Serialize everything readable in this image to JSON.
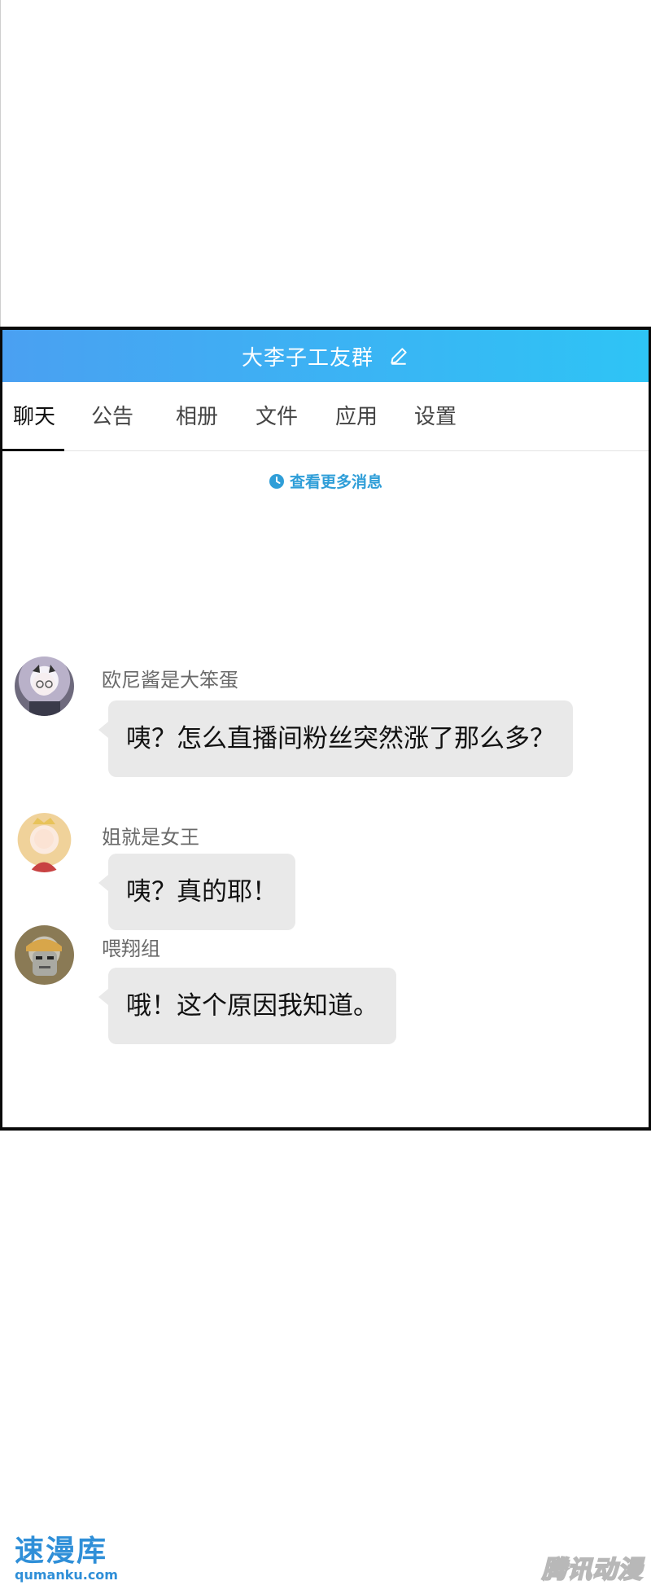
{
  "header": {
    "title": "大李子工友群",
    "edit_icon": "edit-pencil-icon"
  },
  "tabs": [
    "聊天",
    "公告",
    "相册",
    "文件",
    "应用",
    "设置"
  ],
  "active_tab": "聊天",
  "more_messages": {
    "label": "查看更多消息",
    "icon": "clock-icon"
  },
  "messages": [
    {
      "sender": "欧尼酱是大笨蛋",
      "text": "咦？怎么直播间粉丝突然涨了那么多？"
    },
    {
      "sender": "姐就是女王",
      "text": "咦？真的耶！"
    },
    {
      "sender": "喂翔组",
      "text": "哦！这个原因我知道。"
    }
  ],
  "colors": {
    "header_gradient_start": "#4aa0f2",
    "header_gradient_end": "#2ec4f5",
    "link_blue": "#2f9ed8",
    "bubble_bg": "#e9e9e9"
  },
  "watermarks": {
    "left_cn": "速漫库",
    "left_en": "qumanku.com",
    "right": "腾讯动漫"
  }
}
